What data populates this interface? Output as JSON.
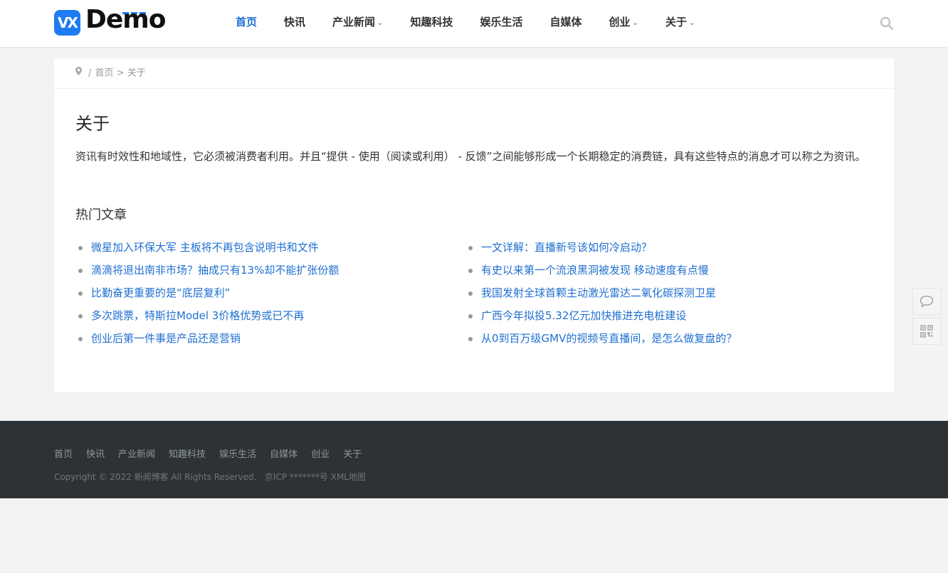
{
  "header": {
    "logo_text": "Demo",
    "logo_icon": "VX",
    "nav": [
      {
        "label": "首页",
        "active": true,
        "dropdown": false
      },
      {
        "label": "快讯",
        "active": false,
        "dropdown": false
      },
      {
        "label": "产业新闻",
        "active": false,
        "dropdown": true
      },
      {
        "label": "知趣科技",
        "active": false,
        "dropdown": false
      },
      {
        "label": "娱乐生活",
        "active": false,
        "dropdown": false
      },
      {
        "label": "自媒体",
        "active": false,
        "dropdown": false
      },
      {
        "label": "创业",
        "active": false,
        "dropdown": true
      },
      {
        "label": "关于",
        "active": false,
        "dropdown": true
      }
    ],
    "search_icon": "search-icon",
    "accent_color": "#1e6fd0"
  },
  "breadcrumb": {
    "home_icon": "location-pin-icon",
    "home": "首页",
    "separator": ">",
    "current": "关于"
  },
  "page": {
    "title": "关于",
    "intro": "资讯有时效性和地域性，它必须被消费者利用。并且“提供 - 使用（阅读或利用） - 反馈”之间能够形成一个长期稳定的消费链，具有这些特点的消息才可以称之为资讯。",
    "hot_title": "热门文章",
    "hot_articles": [
      "微星加入环保大军 主板将不再包含说明书和文件",
      "一文详解：直播新号该如何冷启动？",
      "滴滴将退出南非市场？抽成只有13%却不能扩张份额",
      "有史以来第一个流浪黑洞被发现 移动速度有点慢",
      "比勤奋更重要的是“底层复利”",
      "我国发射全球首颗主动激光雷达二氧化碳探测卫星",
      "多次跳票，特斯拉Model 3价格优势或已不再",
      "广西今年拟投5.32亿元加快推进充电桩建设",
      "创业后第一件事是产品还是营销",
      "从0到百万级GMV的视频号直播间，是怎么做复盘的？"
    ]
  },
  "side_tools": [
    "comment-icon",
    "qrcode-icon"
  ],
  "footer": {
    "nav": [
      "首页",
      "快讯",
      "产业新闻",
      "知趣科技",
      "娱乐生活",
      "自媒体",
      "创业",
      "关于"
    ],
    "copyright": "Copyright © 2022 新闻博客 All Rights Reserved.",
    "icp": "京ICP *******号",
    "sitemap": "XML地图"
  }
}
